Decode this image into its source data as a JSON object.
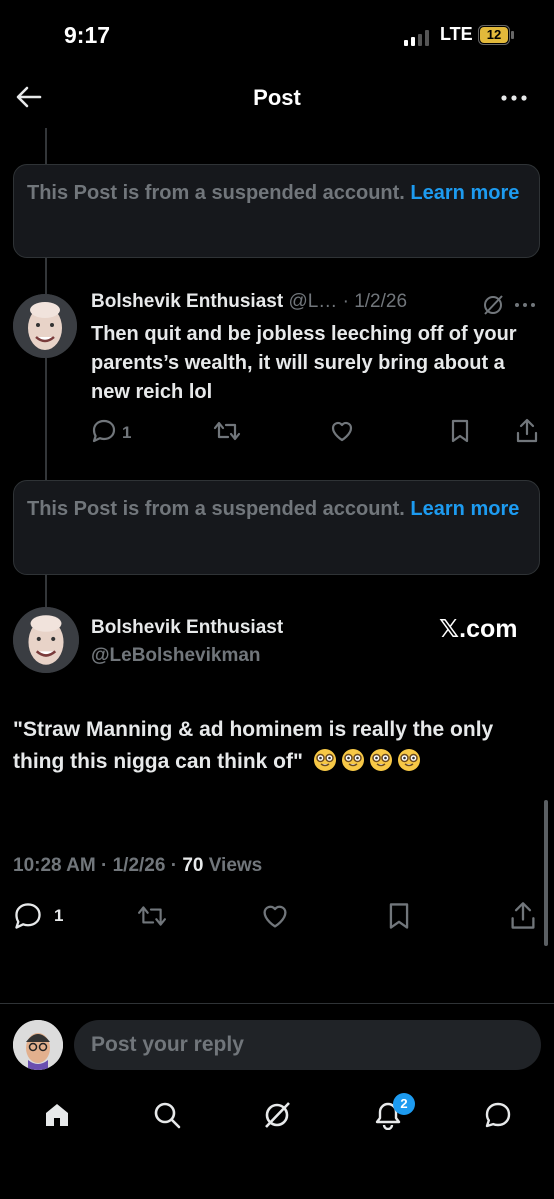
{
  "status_bar": {
    "time": "9:17",
    "network": "LTE",
    "battery": "12"
  },
  "header": {
    "title": "Post"
  },
  "suspended_notice": {
    "text": "This Post is from a suspended account.",
    "link": "Learn more"
  },
  "reply_tweet": {
    "name": "Bolshevik Enthusiast",
    "handle_date": "@L… · 1/2/26",
    "text": "Then quit and be jobless leeching off of your parents’s wealth, it will surely bring about a new reich lol",
    "reply_count": "1"
  },
  "main_tweet": {
    "name": "Bolshevik Enthusiast",
    "handle": "@LeBolshevikman",
    "source": "𝕏.com",
    "text": "\"Straw Manning & ad hominem is really the only thing this nigga can think of\"",
    "timestamp": "10:28 AM · 1/2/26 · ",
    "views_count": "70",
    "views_label": " Views",
    "reply_count": "1"
  },
  "reply_input": {
    "placeholder": "Post your reply"
  },
  "bottom_nav": {
    "notification_badge": "2"
  },
  "colors": {
    "accent": "#1d9bf0",
    "muted": "#71767b",
    "background": "#000000"
  }
}
